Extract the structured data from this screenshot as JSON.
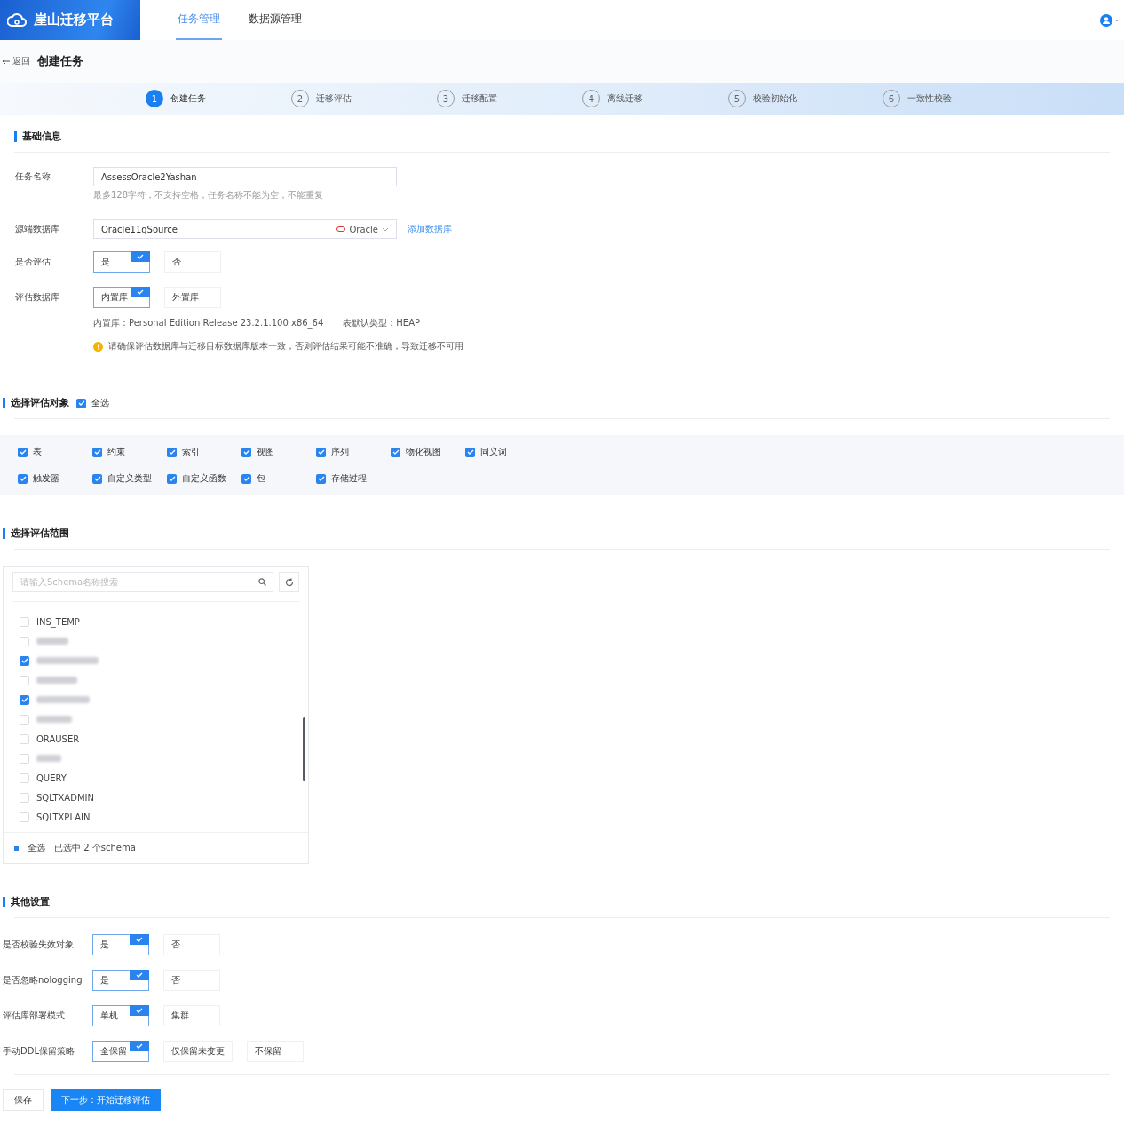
{
  "header": {
    "logo": "崖山迁移平台",
    "nav": [
      {
        "label": "任务管理",
        "selected": true
      },
      {
        "label": "数据源管理",
        "selected": false
      }
    ]
  },
  "page": {
    "back": "返回",
    "title": "创建任务"
  },
  "steps": [
    {
      "number": "1",
      "label": "创建任务",
      "selected": true
    },
    {
      "number": "2",
      "label": "迁移评估",
      "selected": false
    },
    {
      "number": "3",
      "label": "迁移配置",
      "selected": false
    },
    {
      "number": "4",
      "label": "离线迁移",
      "selected": false
    },
    {
      "number": "5",
      "label": "校验初始化",
      "selected": false
    },
    {
      "number": "6",
      "label": "一致性校验",
      "selected": false
    }
  ],
  "basic": {
    "title": "基础信息",
    "task_name": {
      "label": "任务名称",
      "value": "AssessOracle2Yashan",
      "hint": "最多128字符，不支持空格，任务名称不能为空，不能重复"
    },
    "source_db": {
      "label": "源端数据库",
      "value": "Oracle11gSource",
      "tag": "Oracle",
      "link": "添加数据库"
    },
    "choices": [
      {
        "label": "是否评估",
        "options": [
          {
            "label": "是",
            "selected": true
          },
          {
            "label": "否",
            "selected": false
          }
        ]
      },
      {
        "label": "评估数据库",
        "options": [
          {
            "label": "内置库",
            "selected": true
          },
          {
            "label": "外置库",
            "selected": false
          }
        ]
      }
    ],
    "info": [
      "内置库：Personal Edition Release 23.2.1.100 x86_64",
      "表默认类型：HEAP"
    ],
    "warning": "请确保评估数据库与迁移目标数据库版本一致，否则评估结果可能不准确，导致迁移不可用"
  },
  "objects": {
    "title": "选择评估对象",
    "select_all": {
      "label": "全选",
      "checked": true
    },
    "items": [
      {
        "label": "表",
        "checked": true
      },
      {
        "label": "约束",
        "checked": true
      },
      {
        "label": "索引",
        "checked": true
      },
      {
        "label": "视图",
        "checked": true
      },
      {
        "label": "序列",
        "checked": true
      },
      {
        "label": "物化视图",
        "checked": true
      },
      {
        "label": "同义词",
        "checked": true
      },
      {
        "label": "触发器",
        "checked": true
      },
      {
        "label": "自定义类型",
        "checked": true
      },
      {
        "label": "自定义函数",
        "checked": true
      },
      {
        "label": "包",
        "checked": true
      },
      {
        "label": "存储过程",
        "checked": true
      }
    ]
  },
  "scope": {
    "title": "选择评估范围",
    "search": {
      "placeholder": "请输入Schema名称搜索"
    },
    "schemas": [
      {
        "kind": "name",
        "name": "INS_TEMP",
        "checked": false
      },
      {
        "kind": "redacted",
        "checked": false
      },
      {
        "kind": "redacted",
        "checked": true
      },
      {
        "kind": "redacted",
        "checked": false
      },
      {
        "kind": "redacted",
        "checked": true
      },
      {
        "kind": "redacted",
        "checked": false
      },
      {
        "kind": "name",
        "name": "ORAUSER",
        "checked": false
      },
      {
        "kind": "redacted",
        "checked": false
      },
      {
        "kind": "name",
        "name": "QUERY",
        "checked": false
      },
      {
        "kind": "name",
        "name": "SQLTXADMIN",
        "checked": false
      },
      {
        "kind": "name",
        "name": "SQLTXPLAIN",
        "checked": false
      }
    ],
    "footer": {
      "select_all": "全选",
      "count": "已选中 2 个schema"
    }
  },
  "other": {
    "title": "其他设置",
    "choices": [
      {
        "label": "是否校验失效对象",
        "options": [
          {
            "label": "是",
            "selected": true
          },
          {
            "label": "否",
            "selected": false
          }
        ]
      },
      {
        "label": "是否忽略nologging",
        "options": [
          {
            "label": "是",
            "selected": true
          },
          {
            "label": "否",
            "selected": false
          }
        ]
      },
      {
        "label": "评估库部署模式",
        "options": [
          {
            "label": "单机",
            "selected": true
          },
          {
            "label": "集群",
            "selected": false
          }
        ]
      },
      {
        "label": "手动DDL保留策略",
        "options": [
          {
            "label": "全保留",
            "selected": true
          },
          {
            "label": "仅保留未变更",
            "selected": false
          },
          {
            "label": "不保留",
            "selected": false
          }
        ]
      }
    ]
  },
  "actions": [
    {
      "kind": "secondary",
      "label": "保存"
    },
    {
      "kind": "primary",
      "label": "下一步：开始迁移评估"
    }
  ]
}
